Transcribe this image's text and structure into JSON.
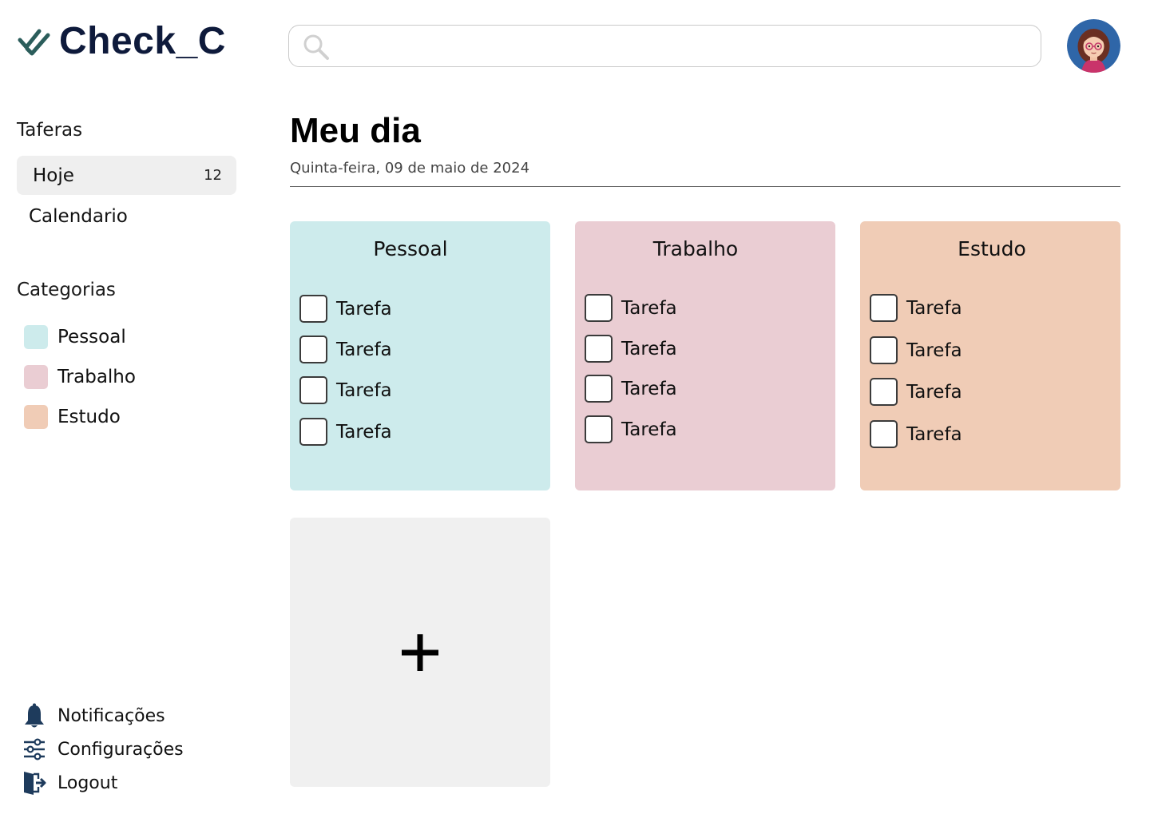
{
  "app": {
    "logo_text": "Check_C",
    "accent_color": "#2b5d5b",
    "logo_color": "#0e1a3b"
  },
  "search": {
    "placeholder": "",
    "value": ""
  },
  "sidebar": {
    "tasks_title": "Taferas",
    "nav": [
      {
        "label": "Hoje",
        "count": "12",
        "active": true
      },
      {
        "label": "Calendario",
        "count": "",
        "active": false
      }
    ],
    "categories_title": "Categorias",
    "categories": [
      {
        "label": "Pessoal",
        "color": "#cdebec"
      },
      {
        "label": "Trabalho",
        "color": "#eacdd3"
      },
      {
        "label": "Estudo",
        "color": "#f0ccb6"
      }
    ],
    "bottom": [
      {
        "label": "Notificações",
        "icon": "bell-icon"
      },
      {
        "label": "Configurações",
        "icon": "sliders-icon"
      },
      {
        "label": "Logout",
        "icon": "logout-icon"
      }
    ]
  },
  "main": {
    "title": "Meu dia",
    "date": "Quinta-feira, 09 de maio de 2024",
    "cards": [
      {
        "title": "Pessoal",
        "color": "#cdebec",
        "tasks": [
          "Tarefa",
          "Tarefa",
          "Tarefa",
          "Tarefa"
        ]
      },
      {
        "title": "Trabalho",
        "color": "#eacdd3",
        "tasks": [
          "Tarefa",
          "Tarefa",
          "Tarefa",
          "Tarefa"
        ]
      },
      {
        "title": "Estudo",
        "color": "#f0ccb6",
        "tasks": [
          "Tarefa",
          "Tarefa",
          "Tarefa",
          "Tarefa"
        ]
      }
    ],
    "add_card_icon": "plus-icon"
  }
}
